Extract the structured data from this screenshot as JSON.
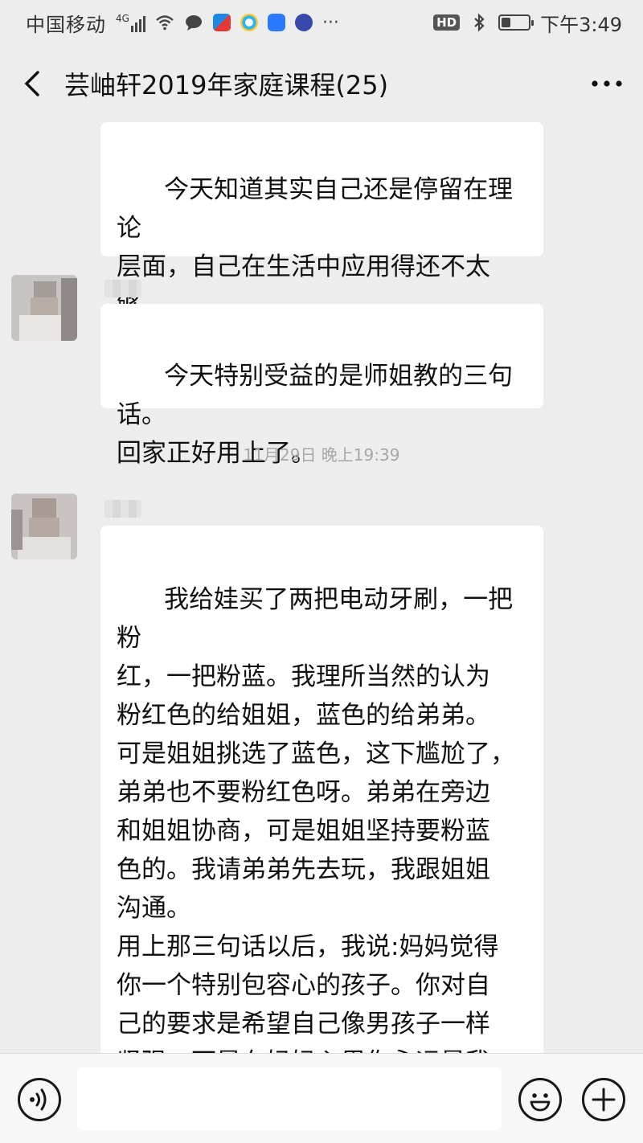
{
  "status_bar": {
    "carrier": "中国移动",
    "network": "4G",
    "hd": "HD",
    "time": "下午3:49",
    "battery_level": 0.35
  },
  "nav": {
    "title": "芸岫轩2019年家庭课程(25)",
    "back_icon": "chevron-left-icon",
    "more_icon": "more-horizontal-icon"
  },
  "messages": [
    {
      "text": "今天知道其实自己还是停留在理论\n层面，自己在生活中应用得还不太\n够。"
    },
    {
      "text": "今天特别受益的是师姐教的三句话。\n回家正好用上了。"
    },
    {
      "text": "我给娃买了两把电动牙刷，一把粉\n红，一把粉蓝。我理所当然的认为\n粉红色的给姐姐，蓝色的给弟弟。\n可是姐姐挑选了蓝色，这下尴尬了，\n弟弟也不要粉红色呀。弟弟在旁边\n和姐姐协商，可是姐姐坚持要粉蓝\n色的。我请弟弟先去玩，我跟姐姐\n沟通。\n用上那三句话以后，我说:妈妈觉得\n你一个特别包容心的孩子。你对自\n己的要求是希望自己像男孩子一样\n坚强。可是在妈妈心里你永远是我\n的小公主。你可以粉粉嫩嫩的，可"
    }
  ],
  "timestamp": "11月29日 晚上19:39",
  "input_bar": {
    "voice_icon": "voice-icon",
    "emoji_icon": "emoji-icon",
    "plus_icon": "plus-circle-icon",
    "input_value": ""
  }
}
